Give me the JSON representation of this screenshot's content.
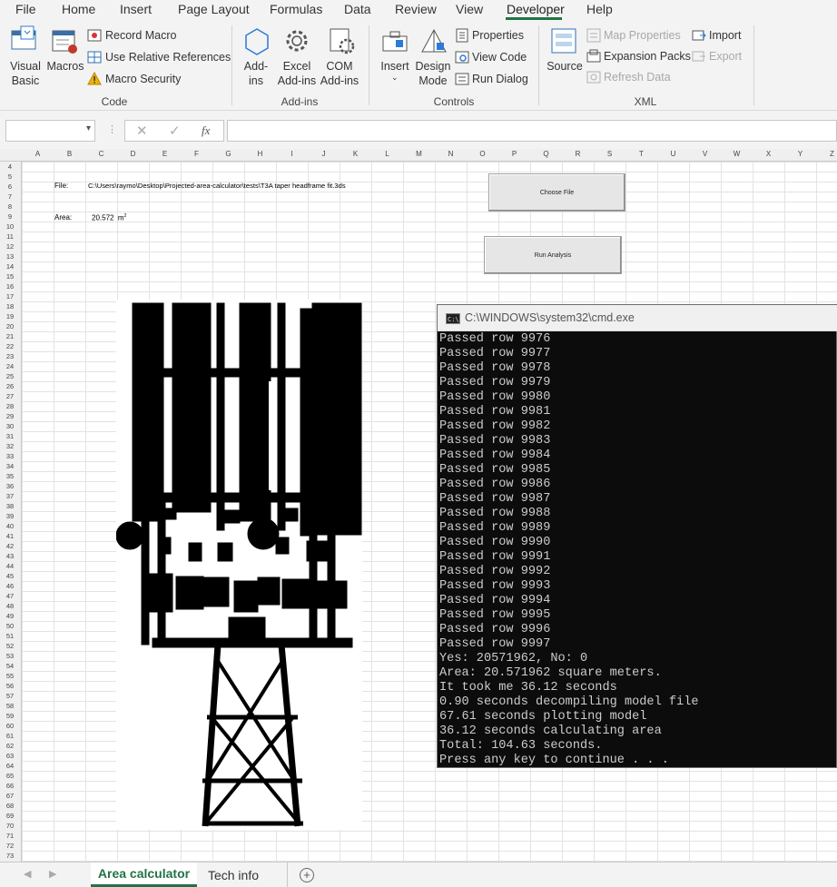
{
  "ribbon_tabs": [
    "File",
    "Home",
    "Insert",
    "Page Layout",
    "Formulas",
    "Data",
    "Review",
    "View",
    "Developer",
    "Help"
  ],
  "active_tab": "Developer",
  "code_group": {
    "visual_basic": "Visual Basic",
    "visual_basic_l1": "Visual",
    "visual_basic_l2": "Basic",
    "macros": "Macros",
    "record_macro": "Record Macro",
    "use_relative": "Use Relative References",
    "macro_security": "Macro Security",
    "label": "Code"
  },
  "addins_group": {
    "addins_l1": "Add-",
    "addins_l2": "ins",
    "excel_l1": "Excel",
    "excel_l2": "Add-ins",
    "com_l1": "COM",
    "com_l2": "Add-ins",
    "label": "Add-ins"
  },
  "controls_group": {
    "insert": "Insert",
    "design_l1": "Design",
    "design_l2": "Mode",
    "properties": "Properties",
    "view_code": "View Code",
    "run_dialog": "Run Dialog",
    "label": "Controls"
  },
  "xml_group": {
    "source": "Source",
    "map_properties": "Map Properties",
    "expansion_packs": "Expansion Packs",
    "refresh_data": "Refresh Data",
    "import": "Import",
    "export": "Export",
    "label": "XML"
  },
  "formula_bar": {
    "name_box": "",
    "fx": "fx",
    "formula": ""
  },
  "columns": [
    "A",
    "B",
    "C",
    "D",
    "E",
    "F",
    "G",
    "H",
    "I",
    "J",
    "K",
    "L",
    "M",
    "N",
    "O",
    "P",
    "Q",
    "R",
    "S",
    "T",
    "U",
    "V",
    "W",
    "X",
    "Y",
    "Z"
  ],
  "first_row": 4,
  "last_row": 73,
  "cells": {
    "file_label": "File:",
    "file_path": "C:\\Users\\raymo\\Desktop\\Projected-area-calculator\\tests\\T3A taper headframe fit.3ds",
    "area_label": "Area:",
    "area_value": "20.572",
    "area_unit": "m",
    "area_exp": "2"
  },
  "buttons": {
    "choose_file": "Choose File",
    "run_analysis": "Run Analysis"
  },
  "cmd": {
    "title": "C:\\WINDOWS\\system32\\cmd.exe",
    "lines": [
      "Passed row 9976",
      "Passed row 9977",
      "Passed row 9978",
      "Passed row 9979",
      "Passed row 9980",
      "Passed row 9981",
      "Passed row 9982",
      "Passed row 9983",
      "Passed row 9984",
      "Passed row 9985",
      "Passed row 9986",
      "Passed row 9987",
      "Passed row 9988",
      "Passed row 9989",
      "Passed row 9990",
      "Passed row 9991",
      "Passed row 9992",
      "Passed row 9993",
      "Passed row 9994",
      "Passed row 9995",
      "Passed row 9996",
      "Passed row 9997",
      "Yes: 20571962, No: 0",
      "Area: 20.571962 square meters.",
      "It took me 36.12 seconds",
      "0.90 seconds decompiling model file",
      "67.61 seconds plotting model",
      "36.12 seconds calculating area",
      "Total: 104.63 seconds.",
      "Press any key to continue . . ."
    ]
  },
  "sheet_tabs": [
    "Area calculator",
    "Tech info"
  ],
  "active_sheet": "Area calculator",
  "accent": "#217346"
}
